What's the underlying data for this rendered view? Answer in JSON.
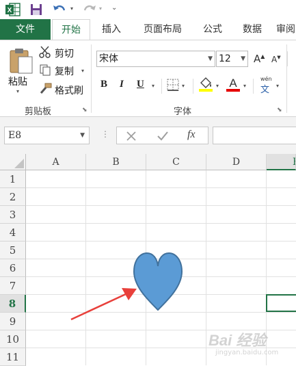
{
  "quick_access": {
    "excel_logo": "excel-logo-icon",
    "save": "save-icon",
    "undo": "undo-icon",
    "redo": "redo-icon",
    "customize": "customize-qat-icon"
  },
  "tabs": {
    "file": "文件",
    "home": "开始",
    "insert": "插入",
    "page_layout": "页面布局",
    "formulas": "公式",
    "data": "数据",
    "review": "审阅"
  },
  "clipboard": {
    "paste": "粘贴",
    "cut": "剪切",
    "copy": "复制",
    "format_painter": "格式刷",
    "group_label": "剪贴板"
  },
  "font": {
    "name": "宋体",
    "size": "12",
    "grow": "A",
    "shrink": "A",
    "bold": "B",
    "italic": "I",
    "underline": "U",
    "group_label": "字体",
    "phonetic_top": "wén",
    "phonetic_bottom": "文"
  },
  "colors": {
    "accent": "#217346",
    "highlight": "#ffff00",
    "font_color": "#ff0000",
    "heart_fill": "#5b9bd5",
    "heart_stroke": "#41719c",
    "arrow": "#e8403b",
    "selection": "#217346"
  },
  "formula_bar": {
    "name_box": "E8",
    "fx": "fx",
    "formula": ""
  },
  "columns": [
    "A",
    "B",
    "C",
    "D",
    "E"
  ],
  "rows": [
    "1",
    "2",
    "3",
    "4",
    "5",
    "6",
    "7",
    "8",
    "9",
    "10",
    "11"
  ],
  "selected_row": "8",
  "shapes": {
    "heart": "heart-shape",
    "arrow": "red-arrow-annotation"
  },
  "watermark": {
    "text": "Bai 经验",
    "sub": "jingyan.baidu.com"
  }
}
